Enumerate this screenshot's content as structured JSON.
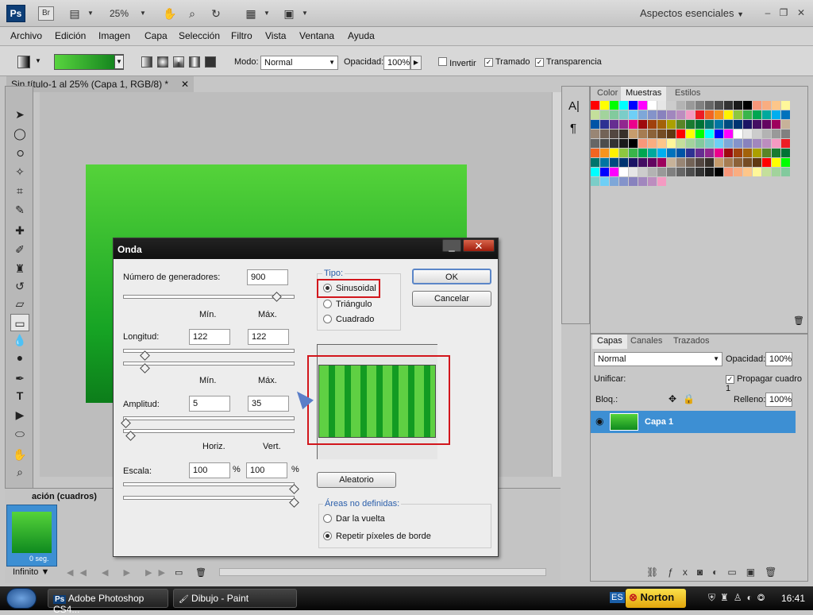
{
  "app": {
    "logo": "Ps",
    "bridge": "Br",
    "zoom": "25%",
    "workspace": "Aspectos esenciales"
  },
  "menu": [
    "Archivo",
    "Edición",
    "Imagen",
    "Capa",
    "Selección",
    "Filtro",
    "Vista",
    "Ventana",
    "Ayuda"
  ],
  "options": {
    "mode_label": "Modo:",
    "mode_value": "Normal",
    "opacity_label": "Opacidad:",
    "opacity_value": "100%",
    "invert_label": "Invertir",
    "invert_checked": false,
    "dither_label": "Tramado",
    "dither_checked": true,
    "transparency_label": "Transparencia",
    "transparency_checked": true
  },
  "document": {
    "tab_title": "Sin título-1 al 25% (Capa 1, RGB/8) *"
  },
  "dialog": {
    "title": "Onda",
    "generators_label": "Número de generadores:",
    "generators_value": "900",
    "min_label": "Mín.",
    "max_label": "Máx.",
    "wavelength_label": "Longitud:",
    "wavelength_min": "122",
    "wavelength_max": "122",
    "amplitude_label": "Amplitud:",
    "amplitude_min": "5",
    "amplitude_max": "35",
    "horiz_label": "Horiz.",
    "vert_label": "Vert.",
    "scale_label": "Escala:",
    "scale_horiz": "100",
    "scale_vert": "100",
    "percent": "%",
    "type_label": "Tipo:",
    "types": [
      {
        "label": "Sinusoidal",
        "selected": true
      },
      {
        "label": "Triángulo",
        "selected": false
      },
      {
        "label": "Cuadrado",
        "selected": false
      }
    ],
    "ok": "OK",
    "cancel": "Cancelar",
    "random": "Aleatorio",
    "undefined_label": "Áreas no definidas:",
    "undefined_options": [
      {
        "label": "Dar la vuelta",
        "selected": false
      },
      {
        "label": "Repetir píxeles de borde",
        "selected": true
      }
    ]
  },
  "swatches_panel": {
    "tabs": [
      "Color",
      "Muestras",
      "Estilos"
    ],
    "active": "Muestras"
  },
  "layers_panel": {
    "tabs": [
      "Capas",
      "Canales",
      "Trazados"
    ],
    "blend_mode": "Normal",
    "opacity_label": "Opacidad:",
    "opacity_value": "100%",
    "unify_label": "Unificar:",
    "propagate_label": "Propagar cuadro 1",
    "lock_label": "Bloq.:",
    "fill_label": "Relleno:",
    "fill_value": "100%",
    "layer_name": "Capa 1"
  },
  "animation_panel": {
    "title": "ación (cuadros)",
    "frame_time": "0 seg.",
    "loop": "Infinito"
  },
  "taskbar": {
    "tasks": [
      "Adobe Photoshop CS4...",
      "Dibujo - Paint"
    ],
    "lang": "ES",
    "norton": "Norton",
    "time": "16:41"
  }
}
